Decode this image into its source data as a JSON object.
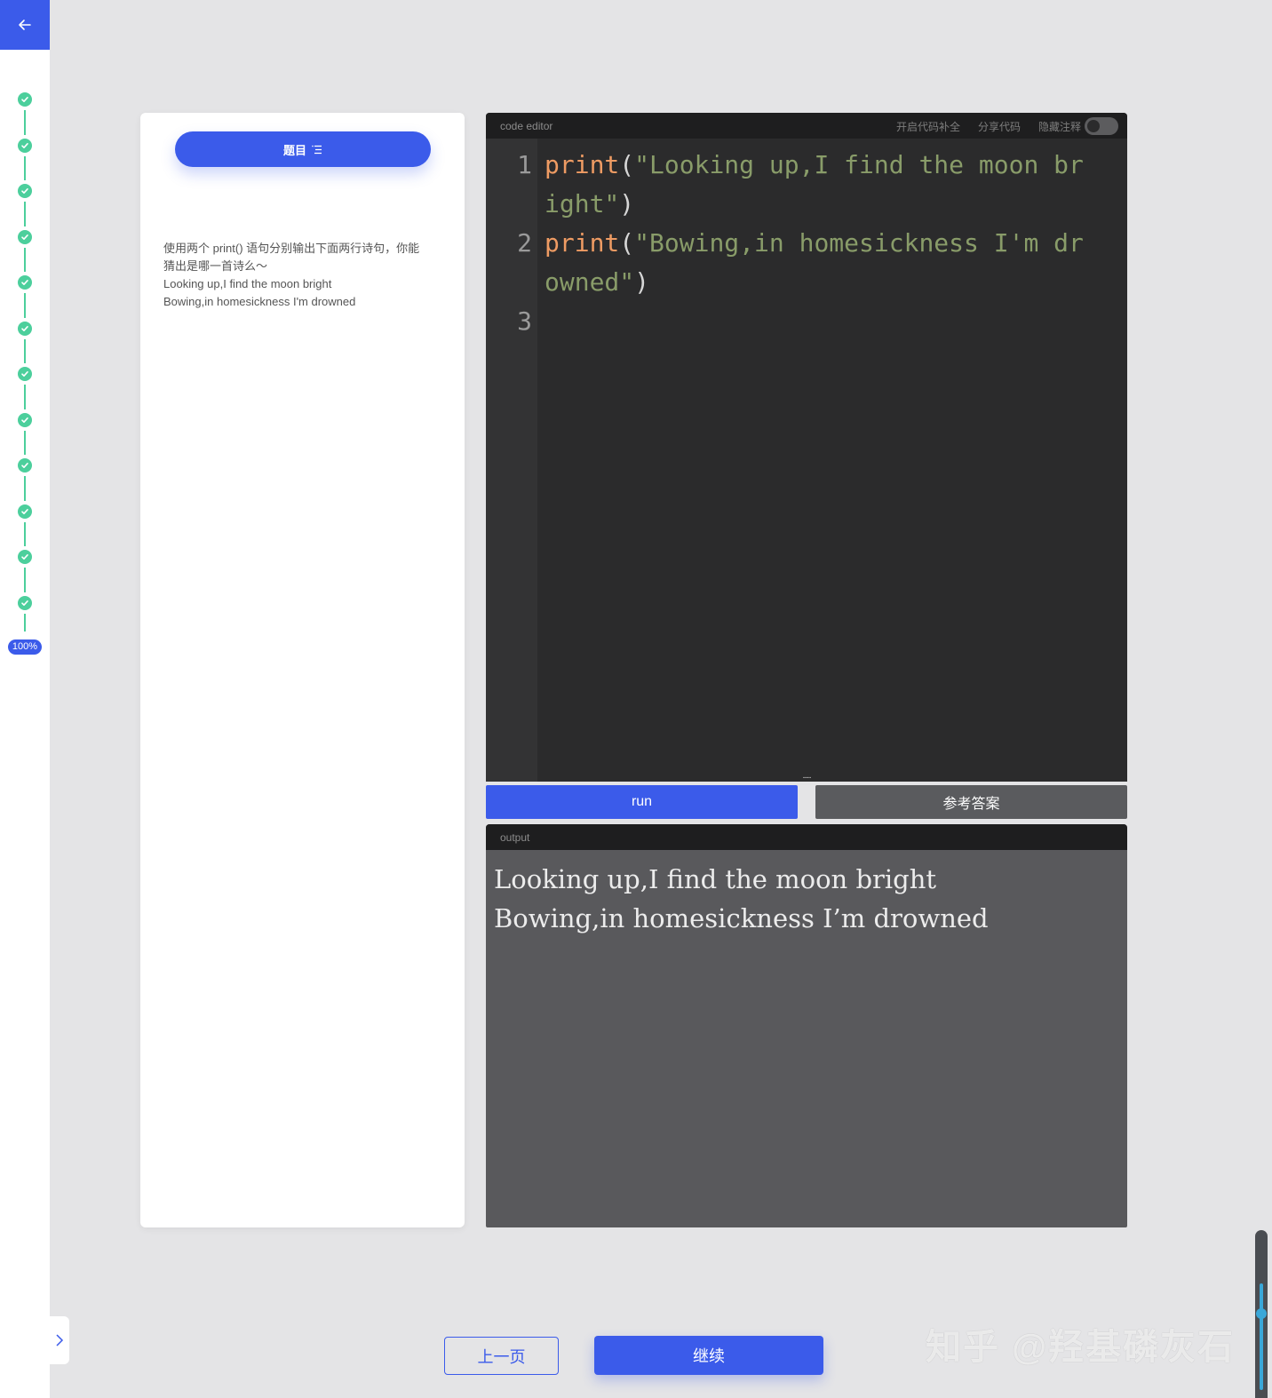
{
  "rail": {
    "progress": "100%",
    "completed_steps": 12
  },
  "question": {
    "title": "题目",
    "text_lines": [
      "使用两个 print() 语句分别输出下面两行诗句，你能",
      "猜出是哪一首诗么～",
      "Looking up,I find the moon bright",
      "Bowing,in homesickness I'm drowned"
    ]
  },
  "editor": {
    "title": "code editor",
    "actions": {
      "autocomplete": "开启代码补全",
      "share": "分享代码",
      "hide_comments": "隐藏注释"
    },
    "line_numbers": [
      "1",
      "2",
      "3"
    ],
    "code": {
      "l1_kw": "print",
      "l1_open": "(",
      "l1_str_a": "\"Looking up,I find the moon br",
      "l1_str_b": "ight\"",
      "l1_close": ")",
      "l2_kw": "print",
      "l2_open": "(",
      "l2_str_a": "\"Bowing,in homesickness I'm dr",
      "l2_str_b": "owned\"",
      "l2_close": ")"
    },
    "resize_handle": "····"
  },
  "buttons": {
    "run": "run",
    "answer": "参考答案",
    "prev": "上一页",
    "next": "继续"
  },
  "output": {
    "title": "output",
    "lines": [
      "Looking up,I find the moon bright",
      "Bowing,in homesickness I’m drowned"
    ]
  },
  "watermark": "知乎 @羟基磷灰石",
  "colors": {
    "accent": "#3b5bea",
    "step_done": "#4ccf9c",
    "editor_bg": "#2b2b2c",
    "output_bg": "#59595c",
    "keyword": "#ee9b63",
    "string": "#899c69"
  }
}
